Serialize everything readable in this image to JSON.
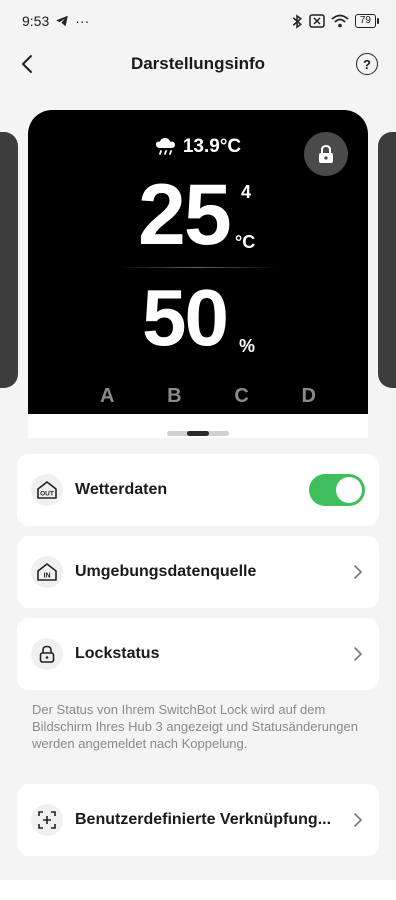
{
  "status_bar": {
    "time": "9:53",
    "extra": "···",
    "battery": "79"
  },
  "header": {
    "title": "Darstellungsinfo",
    "help": "?"
  },
  "device_screen": {
    "weather_temp": "13.9°C",
    "temperature": "25",
    "temperature_decimal": "4",
    "temperature_unit": "°C",
    "humidity": "50",
    "humidity_unit": "%",
    "buttons": [
      "A",
      "B",
      "C",
      "D"
    ]
  },
  "pager": {
    "current": 2,
    "total": 3
  },
  "settings": {
    "weather": {
      "label": "Wetterdaten",
      "enabled": true,
      "icon": "home-out-icon"
    },
    "environment": {
      "label": "Umgebungsdatenquelle",
      "icon": "home-in-icon"
    },
    "lock": {
      "label": "Lockstatus",
      "icon": "lock-icon"
    },
    "lock_note": "Der Status von Ihrem SwitchBot Lock wird auf dem Bildschirm Ihres Hub 3 angezeigt und Statusänderungen werden angemeldet nach Koppelung.",
    "shortcut": {
      "label": "Benutzerdefinierte Verknüpfung...",
      "icon": "shortcut-icon"
    }
  },
  "colors": {
    "toggle_on": "#3fbf5b",
    "screen_bg": "#000000"
  }
}
